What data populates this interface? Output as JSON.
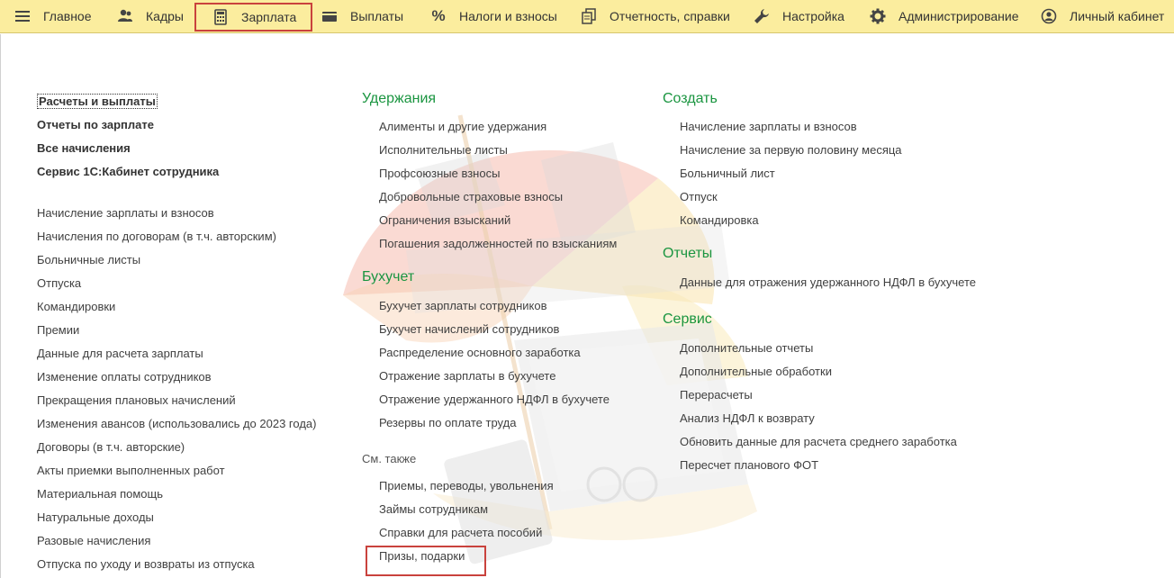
{
  "nav": {
    "items": [
      {
        "label": "Главное",
        "icon": "hamburger-menu-icon"
      },
      {
        "label": "Кадры",
        "icon": "users-icon"
      },
      {
        "label": "Зарплата",
        "icon": "calculator-icon"
      },
      {
        "label": "Выплаты",
        "icon": "wallet-icon"
      },
      {
        "label": "Налоги и взносы",
        "icon": "percent-icon"
      },
      {
        "label": "Отчетность, справки",
        "icon": "documents-icon"
      },
      {
        "label": "Настройка",
        "icon": "wrench-icon"
      },
      {
        "label": "Администрирование",
        "icon": "gear-icon"
      },
      {
        "label": "Личный кабинет",
        "icon": "user-circle-icon"
      }
    ],
    "active": "Зарплата"
  },
  "left": {
    "bold_items": [
      "Расчеты и выплаты",
      "Отчеты по зарплате",
      "Все начисления",
      "Сервис 1С:Кабинет сотрудника"
    ],
    "items": [
      "Начисление зарплаты и взносов",
      "Начисления по договорам (в т.ч. авторским)",
      "Больничные листы",
      "Отпуска",
      "Командировки",
      "Премии",
      "Данные для расчета зарплаты",
      "Изменение оплаты сотрудников",
      "Прекращения плановых начислений",
      "Изменения авансов (использовались до 2023 года)",
      "Договоры (в т.ч. авторские)",
      "Акты приемки выполненных работ",
      "Материальная помощь",
      "Натуральные доходы",
      "Разовые начисления",
      "Отпуска по уходу и возвраты из отпуска"
    ]
  },
  "middle": {
    "deductions": {
      "title": "Удержания",
      "items": [
        "Алименты и другие удержания",
        "Исполнительные листы",
        "Профсоюзные взносы",
        "Добровольные страховые взносы",
        "Ограничения взысканий",
        "Погашения задолженностей по взысканиям"
      ]
    },
    "accounting": {
      "title": "Бухучет",
      "items": [
        "Бухучет зарплаты сотрудников",
        "Бухучет начислений сотрудников",
        "Распределение основного заработка",
        "Отражение зарплаты в бухучете",
        "Отражение удержанного НДФЛ в бухучете",
        "Резервы по оплате труда"
      ]
    },
    "see_also": {
      "title": "См. также",
      "items": [
        "Приемы, переводы, увольнения",
        "Займы сотрудникам",
        "Справки для расчета пособий",
        "Призы, подарки"
      ]
    }
  },
  "right": {
    "create": {
      "title": "Создать",
      "items": [
        "Начисление зарплаты и взносов",
        "Начисление за первую половину месяца",
        "Больничный лист",
        "Отпуск",
        "Командировка"
      ]
    },
    "reports": {
      "title": "Отчеты",
      "items": [
        "Данные для отражения удержанного НДФЛ в бухучете"
      ]
    },
    "service": {
      "title": "Сервис",
      "items": [
        "Дополнительные отчеты",
        "Дополнительные обработки",
        "Перерасчеты",
        "Анализ НДФЛ к возврату",
        "Обновить данные для расчета среднего заработка",
        "Пересчет планового ФОТ"
      ]
    }
  },
  "colors": {
    "topbar": "#fbed9e",
    "section": "#1a9540",
    "highlight": "#c9423d"
  }
}
